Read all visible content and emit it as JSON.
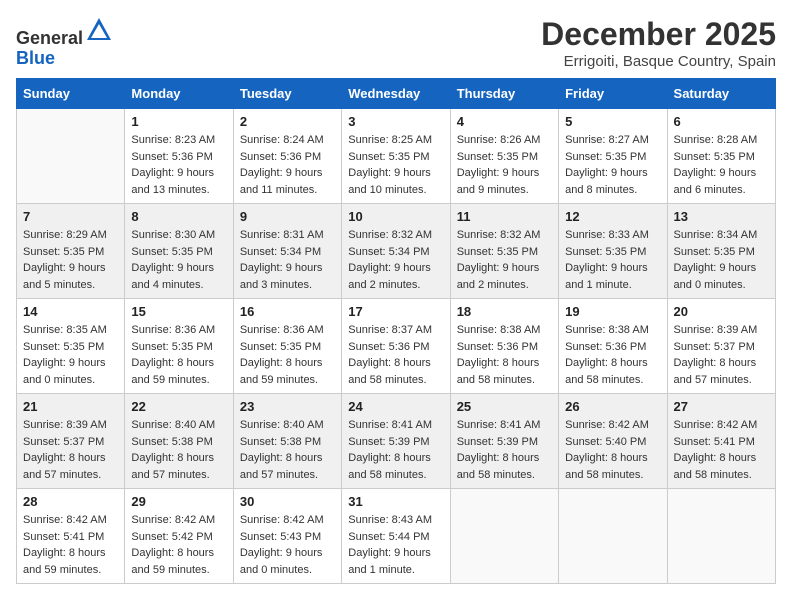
{
  "header": {
    "logo_general": "General",
    "logo_blue": "Blue",
    "month_title": "December 2025",
    "location": "Errigoiti, Basque Country, Spain"
  },
  "weekdays": [
    "Sunday",
    "Monday",
    "Tuesday",
    "Wednesday",
    "Thursday",
    "Friday",
    "Saturday"
  ],
  "weeks": [
    [
      {
        "day": "",
        "sunrise": "",
        "sunset": "",
        "daylight": "",
        "empty": true
      },
      {
        "day": "1",
        "sunrise": "Sunrise: 8:23 AM",
        "sunset": "Sunset: 5:36 PM",
        "daylight": "Daylight: 9 hours and 13 minutes."
      },
      {
        "day": "2",
        "sunrise": "Sunrise: 8:24 AM",
        "sunset": "Sunset: 5:36 PM",
        "daylight": "Daylight: 9 hours and 11 minutes."
      },
      {
        "day": "3",
        "sunrise": "Sunrise: 8:25 AM",
        "sunset": "Sunset: 5:35 PM",
        "daylight": "Daylight: 9 hours and 10 minutes."
      },
      {
        "day": "4",
        "sunrise": "Sunrise: 8:26 AM",
        "sunset": "Sunset: 5:35 PM",
        "daylight": "Daylight: 9 hours and 9 minutes."
      },
      {
        "day": "5",
        "sunrise": "Sunrise: 8:27 AM",
        "sunset": "Sunset: 5:35 PM",
        "daylight": "Daylight: 9 hours and 8 minutes."
      },
      {
        "day": "6",
        "sunrise": "Sunrise: 8:28 AM",
        "sunset": "Sunset: 5:35 PM",
        "daylight": "Daylight: 9 hours and 6 minutes."
      }
    ],
    [
      {
        "day": "7",
        "sunrise": "Sunrise: 8:29 AM",
        "sunset": "Sunset: 5:35 PM",
        "daylight": "Daylight: 9 hours and 5 minutes."
      },
      {
        "day": "8",
        "sunrise": "Sunrise: 8:30 AM",
        "sunset": "Sunset: 5:35 PM",
        "daylight": "Daylight: 9 hours and 4 minutes."
      },
      {
        "day": "9",
        "sunrise": "Sunrise: 8:31 AM",
        "sunset": "Sunset: 5:34 PM",
        "daylight": "Daylight: 9 hours and 3 minutes."
      },
      {
        "day": "10",
        "sunrise": "Sunrise: 8:32 AM",
        "sunset": "Sunset: 5:34 PM",
        "daylight": "Daylight: 9 hours and 2 minutes."
      },
      {
        "day": "11",
        "sunrise": "Sunrise: 8:32 AM",
        "sunset": "Sunset: 5:35 PM",
        "daylight": "Daylight: 9 hours and 2 minutes."
      },
      {
        "day": "12",
        "sunrise": "Sunrise: 8:33 AM",
        "sunset": "Sunset: 5:35 PM",
        "daylight": "Daylight: 9 hours and 1 minute."
      },
      {
        "day": "13",
        "sunrise": "Sunrise: 8:34 AM",
        "sunset": "Sunset: 5:35 PM",
        "daylight": "Daylight: 9 hours and 0 minutes."
      }
    ],
    [
      {
        "day": "14",
        "sunrise": "Sunrise: 8:35 AM",
        "sunset": "Sunset: 5:35 PM",
        "daylight": "Daylight: 9 hours and 0 minutes."
      },
      {
        "day": "15",
        "sunrise": "Sunrise: 8:36 AM",
        "sunset": "Sunset: 5:35 PM",
        "daylight": "Daylight: 8 hours and 59 minutes."
      },
      {
        "day": "16",
        "sunrise": "Sunrise: 8:36 AM",
        "sunset": "Sunset: 5:35 PM",
        "daylight": "Daylight: 8 hours and 59 minutes."
      },
      {
        "day": "17",
        "sunrise": "Sunrise: 8:37 AM",
        "sunset": "Sunset: 5:36 PM",
        "daylight": "Daylight: 8 hours and 58 minutes."
      },
      {
        "day": "18",
        "sunrise": "Sunrise: 8:38 AM",
        "sunset": "Sunset: 5:36 PM",
        "daylight": "Daylight: 8 hours and 58 minutes."
      },
      {
        "day": "19",
        "sunrise": "Sunrise: 8:38 AM",
        "sunset": "Sunset: 5:36 PM",
        "daylight": "Daylight: 8 hours and 58 minutes."
      },
      {
        "day": "20",
        "sunrise": "Sunrise: 8:39 AM",
        "sunset": "Sunset: 5:37 PM",
        "daylight": "Daylight: 8 hours and 57 minutes."
      }
    ],
    [
      {
        "day": "21",
        "sunrise": "Sunrise: 8:39 AM",
        "sunset": "Sunset: 5:37 PM",
        "daylight": "Daylight: 8 hours and 57 minutes."
      },
      {
        "day": "22",
        "sunrise": "Sunrise: 8:40 AM",
        "sunset": "Sunset: 5:38 PM",
        "daylight": "Daylight: 8 hours and 57 minutes."
      },
      {
        "day": "23",
        "sunrise": "Sunrise: 8:40 AM",
        "sunset": "Sunset: 5:38 PM",
        "daylight": "Daylight: 8 hours and 57 minutes."
      },
      {
        "day": "24",
        "sunrise": "Sunrise: 8:41 AM",
        "sunset": "Sunset: 5:39 PM",
        "daylight": "Daylight: 8 hours and 58 minutes."
      },
      {
        "day": "25",
        "sunrise": "Sunrise: 8:41 AM",
        "sunset": "Sunset: 5:39 PM",
        "daylight": "Daylight: 8 hours and 58 minutes."
      },
      {
        "day": "26",
        "sunrise": "Sunrise: 8:42 AM",
        "sunset": "Sunset: 5:40 PM",
        "daylight": "Daylight: 8 hours and 58 minutes."
      },
      {
        "day": "27",
        "sunrise": "Sunrise: 8:42 AM",
        "sunset": "Sunset: 5:41 PM",
        "daylight": "Daylight: 8 hours and 58 minutes."
      }
    ],
    [
      {
        "day": "28",
        "sunrise": "Sunrise: 8:42 AM",
        "sunset": "Sunset: 5:41 PM",
        "daylight": "Daylight: 8 hours and 59 minutes."
      },
      {
        "day": "29",
        "sunrise": "Sunrise: 8:42 AM",
        "sunset": "Sunset: 5:42 PM",
        "daylight": "Daylight: 8 hours and 59 minutes."
      },
      {
        "day": "30",
        "sunrise": "Sunrise: 8:42 AM",
        "sunset": "Sunset: 5:43 PM",
        "daylight": "Daylight: 9 hours and 0 minutes."
      },
      {
        "day": "31",
        "sunrise": "Sunrise: 8:43 AM",
        "sunset": "Sunset: 5:44 PM",
        "daylight": "Daylight: 9 hours and 1 minute."
      },
      {
        "day": "",
        "sunrise": "",
        "sunset": "",
        "daylight": "",
        "empty": true
      },
      {
        "day": "",
        "sunrise": "",
        "sunset": "",
        "daylight": "",
        "empty": true
      },
      {
        "day": "",
        "sunrise": "",
        "sunset": "",
        "daylight": "",
        "empty": true
      }
    ]
  ]
}
